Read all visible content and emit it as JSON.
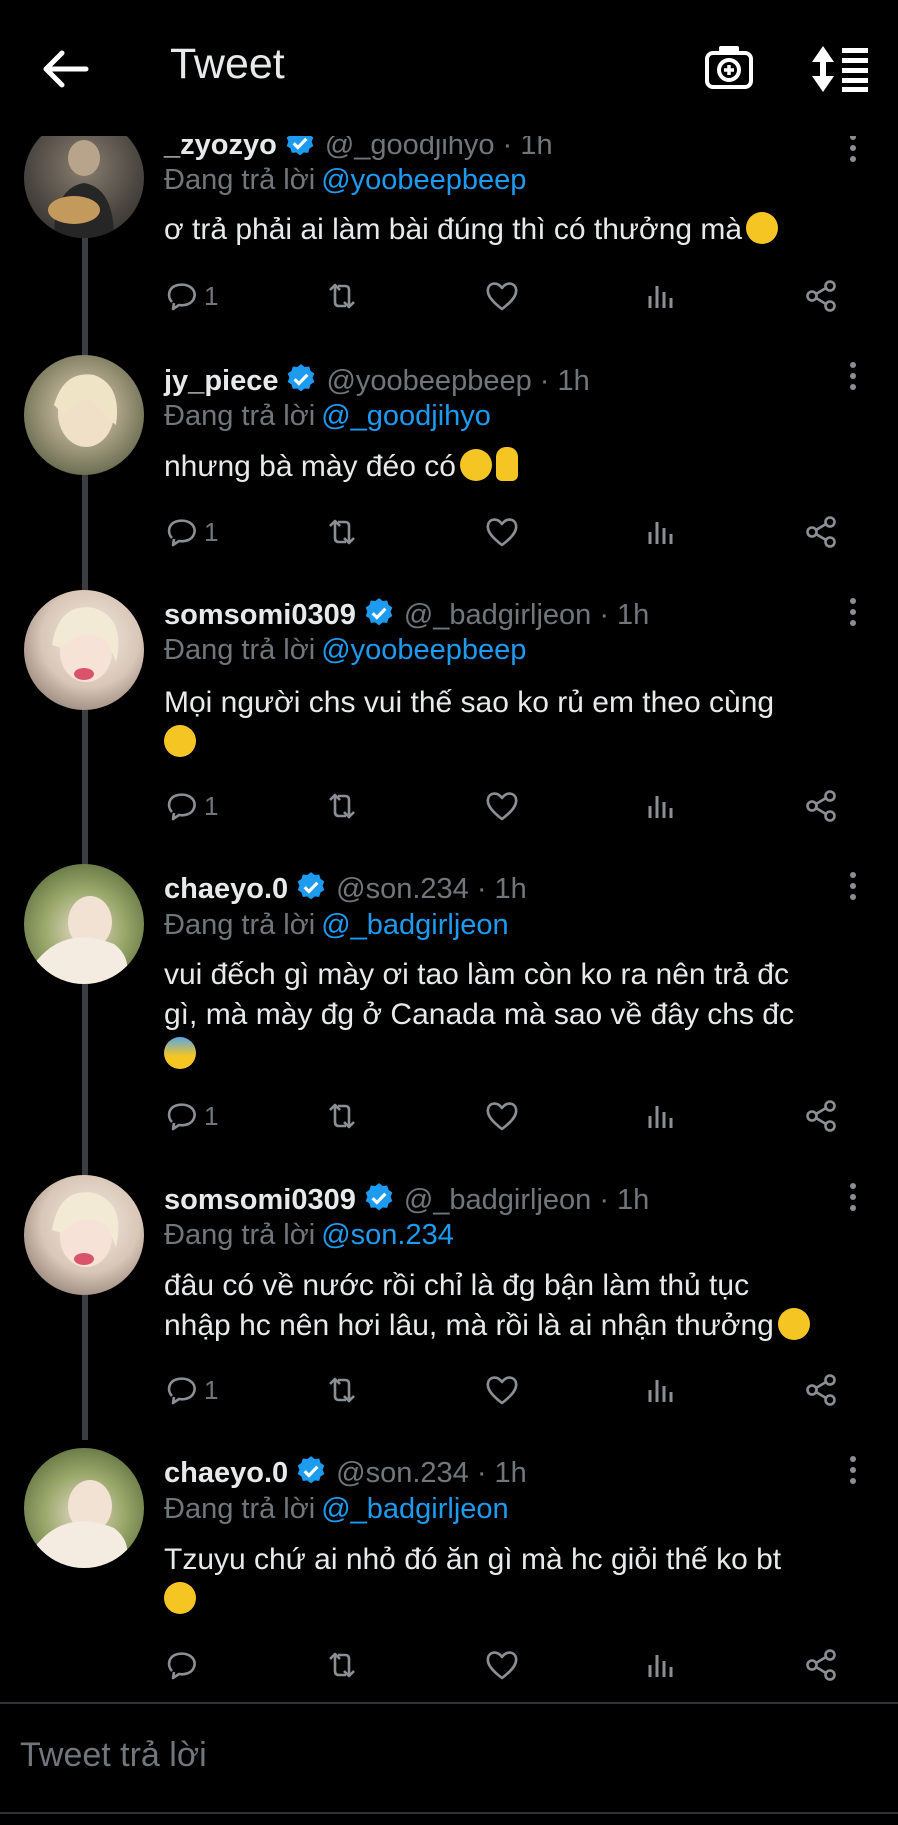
{
  "header": {
    "title": "Tweet"
  },
  "tweets": [
    {
      "name": "_zyozyo",
      "handle": "@_goodjihyo",
      "time": "· 1h",
      "reply_label": "Đang trả lời",
      "reply_to": "@yoobeepbeep",
      "text": "ơ trả phải ai làm bài đúng thì có thưởng mà",
      "replies": "1"
    },
    {
      "name": "jy_piece",
      "handle": "@yoobeepbeep",
      "time": "· 1h",
      "reply_label": "Đang trả lời",
      "reply_to": "@_goodjihyo",
      "text": "nhưng bà mày đéo có",
      "replies": "1"
    },
    {
      "name": "somsomi0309",
      "handle": "@_badgirljeon",
      "time": "· 1h",
      "reply_label": "Đang trả lời",
      "reply_to": "@yoobeepbeep",
      "text": "Mọi người chs vui thế sao ko rủ em theo cùng",
      "replies": "1"
    },
    {
      "name": "chaeyo.0",
      "handle": "@son.234",
      "time": "· 1h",
      "reply_label": "Đang trả lời",
      "reply_to": "@_badgirljeon",
      "text_line1": "vui đếch gì mày ơi tao làm còn ko ra nên trả đc",
      "text_line2": "gì, mà mày đg ở Canada mà sao về đây chs đc",
      "replies": "1"
    },
    {
      "name": "somsomi0309",
      "handle": "@_badgirljeon",
      "time": "· 1h",
      "reply_label": "Đang trả lời",
      "reply_to": "@son.234",
      "text_line1": "đâu có về nước rồi chỉ là đg bận làm thủ tục",
      "text_line2": "nhập hc nên hơi lâu, mà rồi là ai nhận thưởng",
      "replies": "1"
    },
    {
      "name": "chaeyo.0",
      "handle": "@son.234",
      "time": "· 1h",
      "reply_label": "Đang trả lời",
      "reply_to": "@_badgirljeon",
      "text": "Tzuyu chứ ai nhỏ đó ăn gì mà hc giỏi thế ko bt",
      "replies": ""
    }
  ],
  "composer": {
    "placeholder": "Tweet trả lời"
  },
  "colors": {
    "background": "#000000",
    "accent": "#1d9bf0",
    "muted": "#71767b",
    "text": "#e7e9ea"
  }
}
